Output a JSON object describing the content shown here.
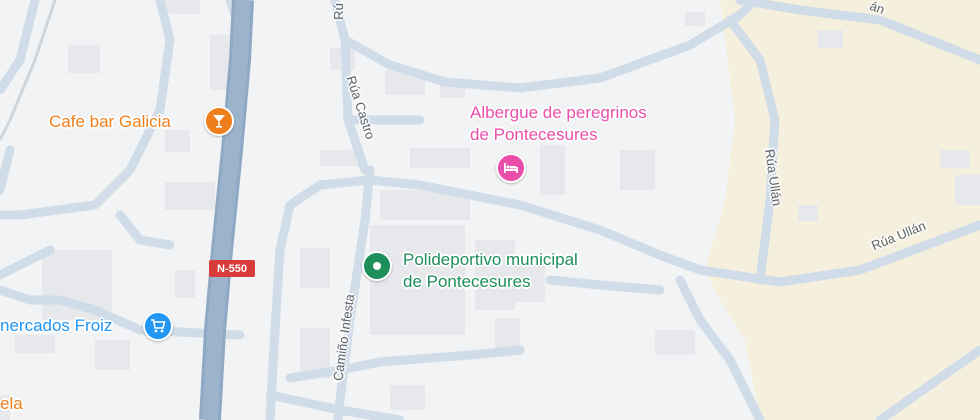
{
  "colors": {
    "background": "#f1f3f4",
    "sand": "#f5efde",
    "road": "#d0dce8",
    "highway": "#8fa8c4",
    "building": "#e6e8eb",
    "lodging": "#e94ea9",
    "cafe": "#ef7f1d",
    "sports": "#1e8e5a",
    "shop": "#2196f3",
    "route_shield": "#d93a3a"
  },
  "pois": {
    "cafe": {
      "name": "Cafe bar Galicia",
      "icon": "cocktail-glass-icon"
    },
    "albergue": {
      "name_line1": "Albergue de peregrinos",
      "name_line2": "de Pontecesures",
      "icon": "bed-icon"
    },
    "polideportivo": {
      "name_line1": "Polideportivo municipal",
      "name_line2": "de Pontecesures",
      "icon": "marker-dot-icon"
    },
    "froiz": {
      "name": "nercados Froiz",
      "icon": "shopping-cart-icon"
    },
    "bottom_left": {
      "name": "ela"
    }
  },
  "roads": {
    "rua_castro": "Rúa Castro",
    "camino_infesta": "Camiño Infesta",
    "rua_ullan_vertical": "Rúa Ullán",
    "rua_ullan_diag": "Rúa Ullán",
    "top_ru": "Rú",
    "top_an": "án"
  },
  "route_shield": "N-550"
}
